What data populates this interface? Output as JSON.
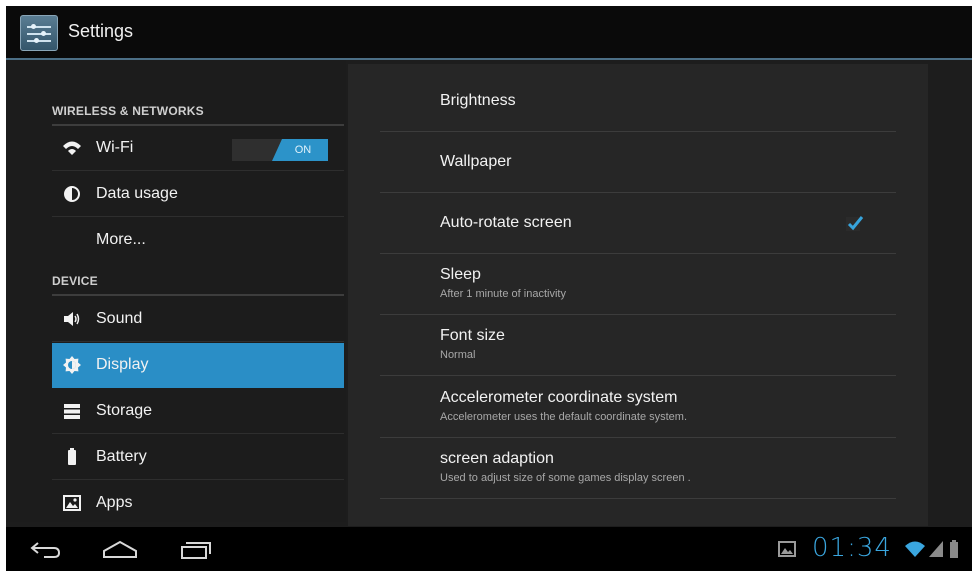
{
  "app": {
    "title": "Settings",
    "icon": "settings-icon"
  },
  "sidebar": {
    "sections": [
      {
        "header": "WIRELESS & NETWORKS"
      },
      {
        "header": "DEVICE"
      }
    ],
    "items": [
      {
        "label": "Wi-Fi",
        "icon": "wifi-icon",
        "toggle": "ON"
      },
      {
        "label": "Data usage",
        "icon": "data-usage-icon"
      },
      {
        "label": "More...",
        "icon": ""
      },
      {
        "label": "Sound",
        "icon": "speaker-icon"
      },
      {
        "label": "Display",
        "icon": "brightness-icon",
        "selected": true
      },
      {
        "label": "Storage",
        "icon": "storage-icon"
      },
      {
        "label": "Battery",
        "icon": "battery-icon"
      },
      {
        "label": "Apps",
        "icon": "apps-icon"
      }
    ]
  },
  "display": {
    "prefs": [
      {
        "title": "Brightness",
        "summary": ""
      },
      {
        "title": "Wallpaper",
        "summary": ""
      },
      {
        "title": "Auto-rotate screen",
        "summary": "",
        "checked": true
      },
      {
        "title": "Sleep",
        "summary": "After 1 minute of inactivity"
      },
      {
        "title": "Font size",
        "summary": "Normal"
      },
      {
        "title": "Accelerometer coordinate system",
        "summary": "Accelerometer uses the default coordinate system."
      },
      {
        "title": "screen adaption",
        "summary": "Used to adjust size of some games display screen ."
      }
    ]
  },
  "statusbar": {
    "clock": "01:34",
    "icons": [
      "gallery-notification-icon",
      "wifi-signal-icon",
      "cell-signal-icon",
      "battery-status-icon"
    ]
  },
  "navbar": {
    "buttons": [
      "back-icon",
      "home-icon",
      "recent-apps-icon"
    ]
  },
  "colors": {
    "accent": "#2a8ec6",
    "clock": "#3aa6df",
    "background": "#1d1d1d"
  }
}
